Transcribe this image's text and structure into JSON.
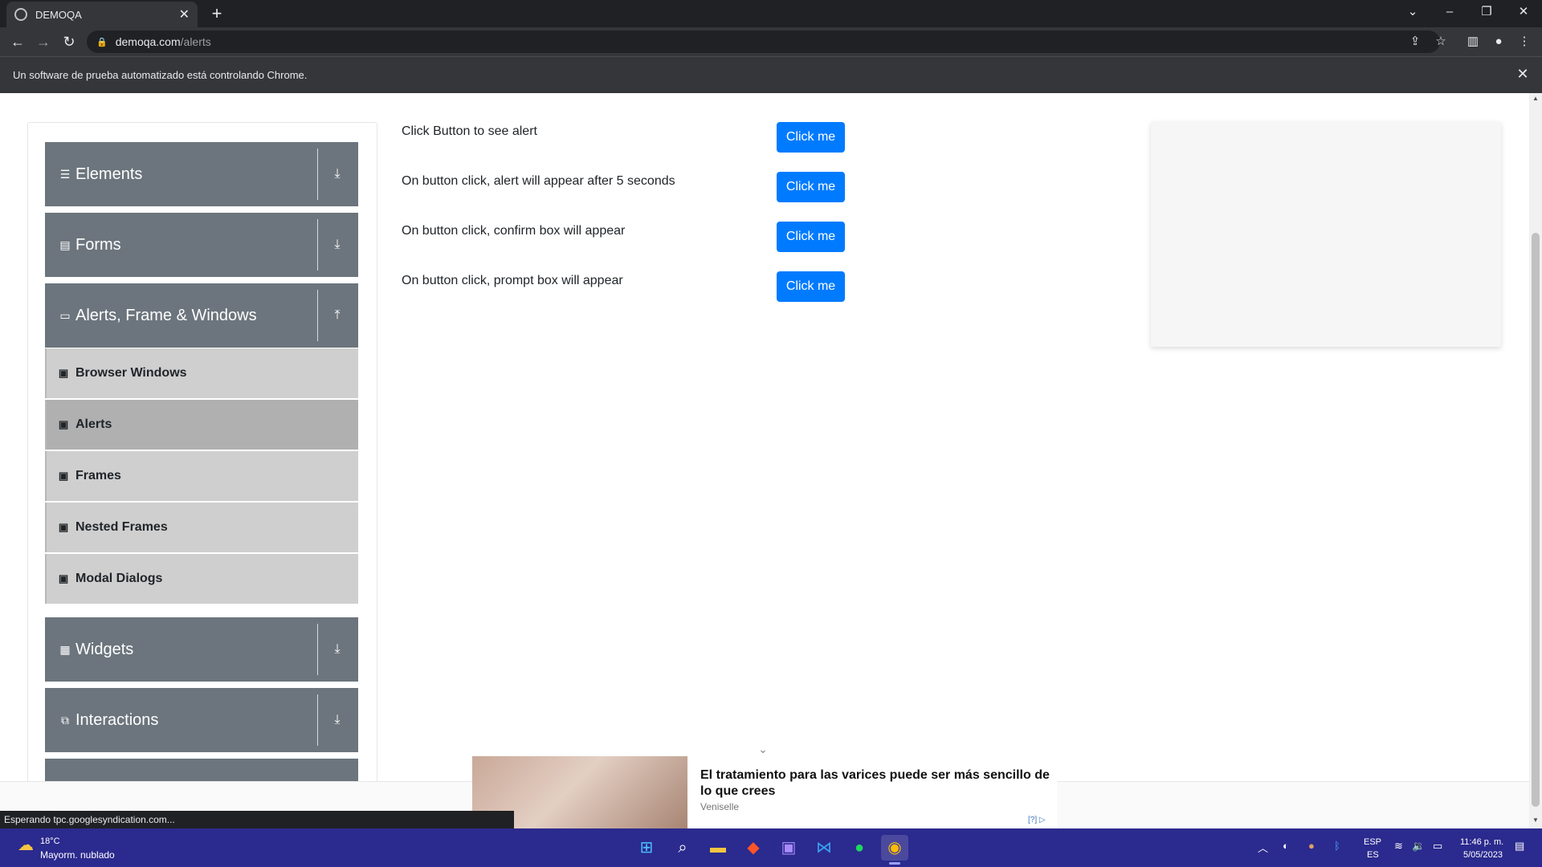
{
  "browser": {
    "tab_title": "DEMOQA",
    "url_host": "demoqa.com",
    "url_path": "/alerts",
    "infobar_text": "Un software de prueba automatizado está controlando Chrome.",
    "status_text": "Esperando tpc.googlesyndication.com..."
  },
  "sidebar": {
    "groups": [
      {
        "label": "Elements",
        "icon": "hamburger-icon",
        "arrow": "download-arrow-icon"
      },
      {
        "label": "Forms",
        "icon": "document-icon",
        "arrow": "download-arrow-icon"
      },
      {
        "label": "Alerts, Frame & Windows",
        "icon": "window-icon",
        "arrow": "upload-arrow-icon"
      },
      {
        "label": "Widgets",
        "icon": "grid-icon",
        "arrow": "download-arrow-icon"
      },
      {
        "label": "Interactions",
        "icon": "interaction-icon",
        "arrow": "download-arrow-icon"
      }
    ],
    "items": [
      {
        "label": "Browser Windows",
        "active": false
      },
      {
        "label": "Alerts",
        "active": true
      },
      {
        "label": "Frames",
        "active": false
      },
      {
        "label": "Nested Frames",
        "active": false
      },
      {
        "label": "Modal Dialogs",
        "active": false
      }
    ]
  },
  "main": {
    "rows": [
      {
        "text": "Click Button to see alert",
        "button": "Click me"
      },
      {
        "text": "On button click, alert will appear after 5 seconds",
        "button": "Click me"
      },
      {
        "text": "On button click, confirm box will appear",
        "button": "Click me"
      },
      {
        "text": "On button click, prompt box will appear",
        "button": "Click me"
      }
    ]
  },
  "ad": {
    "headline": "El tratamiento para las varices puede ser más sencillo de lo que crees",
    "brand": "Veniselle",
    "choice": "[?]"
  },
  "taskbar": {
    "weather_temp": "18°C",
    "weather_desc": "Mayorm. nublado",
    "lang_top": "ESP",
    "lang_bottom": "ES",
    "time": "11:46 p. m.",
    "date": "5/05/2023"
  },
  "colors": {
    "primary_button": "#007bff",
    "sidebar_header": "#6c757d",
    "sidebar_item": "#cfcfcf",
    "sidebar_item_active": "#b0b0b0",
    "taskbar": "#2b2a8e"
  }
}
